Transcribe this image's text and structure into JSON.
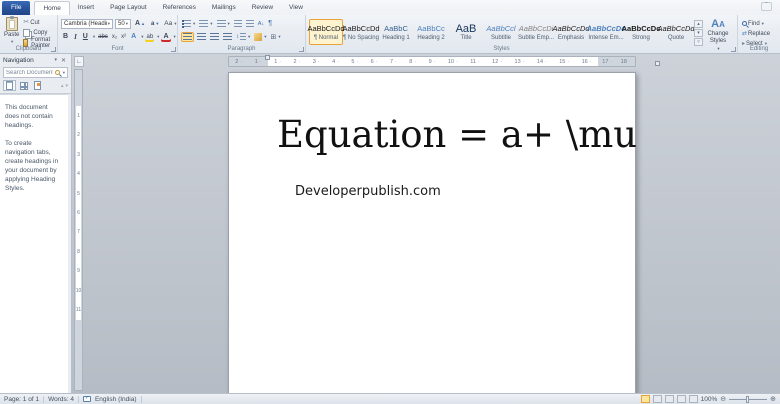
{
  "ribbon": {
    "file_tab": "File",
    "tabs": [
      "Home",
      "Insert",
      "Page Layout",
      "References",
      "Mailings",
      "Review",
      "View"
    ],
    "active_tab": "Home",
    "clipboard": {
      "label": "Clipboard",
      "paste": "Paste",
      "cut": "Cut",
      "copy": "Copy",
      "format_painter": "Format Painter"
    },
    "font": {
      "label": "Font",
      "font_name": "Cambria (Headin",
      "font_size": "50",
      "bold": "B",
      "italic": "I",
      "underline": "U",
      "strikethrough": "abc",
      "subscript": "x₂",
      "superscript": "x²",
      "grow_font": "A",
      "shrink_font": "a",
      "change_case": "Aa",
      "text_effects": "A",
      "highlight": "ab",
      "font_color": "A"
    },
    "paragraph": {
      "label": "Paragraph",
      "pilcrow": "¶",
      "sort": "A↓"
    },
    "styles": {
      "label": "Styles",
      "items": [
        {
          "preview": "AaBbCcDd",
          "label": "¶ Normal"
        },
        {
          "preview": "AaBbCcDd",
          "label": "¶ No Spacing"
        },
        {
          "preview": "AaBbC",
          "label": "Heading 1"
        },
        {
          "preview": "AaBbCc",
          "label": "Heading 2"
        },
        {
          "preview": "AaB",
          "label": "Title"
        },
        {
          "preview": "AaBbCcl",
          "label": "Subtitle"
        },
        {
          "preview": "AaBbCcDi",
          "label": "Subtle Emp..."
        },
        {
          "preview": "AaBbCcDd",
          "label": "Emphasis"
        },
        {
          "preview": "AaBbCcDc",
          "label": "Intense Em..."
        },
        {
          "preview": "AaBbCcDc",
          "label": "Strong"
        },
        {
          "preview": "AaBbCcDd",
          "label": "Quote"
        }
      ]
    },
    "change_styles": {
      "label": "Change Styles",
      "icon_text": "A"
    },
    "editing": {
      "label": "Editing",
      "find": "Find",
      "replace": "Replace",
      "select": "Select"
    }
  },
  "navigation": {
    "title": "Navigation",
    "search_placeholder": "Search Document",
    "paragraphs": [
      "This document does not contain headings.",
      "To create navigation tabs, create headings in your document by applying Heading Styles."
    ]
  },
  "ruler": {
    "left_margin": [
      "2",
      "1"
    ],
    "active": [
      "1",
      "2",
      "3",
      "4",
      "5",
      "6",
      "7",
      "8",
      "9",
      "10",
      "11",
      "12",
      "13",
      "14",
      "15",
      "16"
    ],
    "right_margin": [
      "17",
      "18"
    ],
    "vertical": [
      "1",
      "2",
      "3",
      "4",
      "5",
      "6",
      "7",
      "8",
      "9",
      "10",
      "11"
    ]
  },
  "document": {
    "equation": "Equation = a+ \\mu",
    "subtitle": "Developerpublish.com"
  },
  "status": {
    "page": "Page: 1 of 1",
    "words": "Words: 4",
    "language": "English (India)",
    "zoom": "100%"
  },
  "colors": {
    "selection_orange": "#e9a33d",
    "accent_blue": "#4f81bd",
    "file_tab_blue": "#2a549c",
    "page_white": "#ffffff"
  }
}
